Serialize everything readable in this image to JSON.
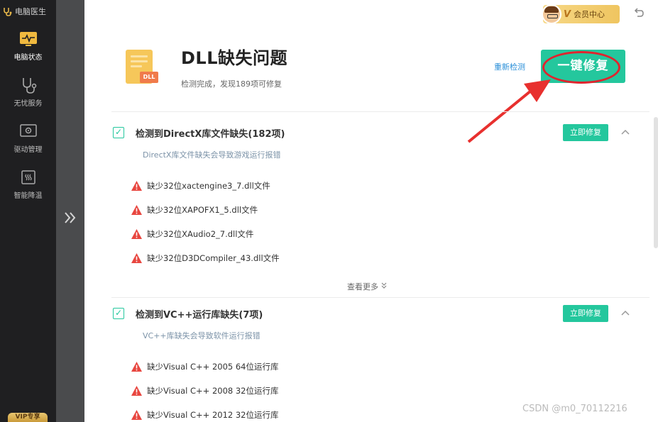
{
  "sidebar": {
    "brand": "电脑医生",
    "items": [
      {
        "label": "电脑状态",
        "icon": "monitor-pulse-icon",
        "active": true
      },
      {
        "label": "无忧服务",
        "icon": "stethoscope-icon",
        "active": false
      },
      {
        "label": "驱动管理",
        "icon": "gear-box-icon",
        "active": false
      },
      {
        "label": "智能降温",
        "icon": "chip-cooling-icon",
        "active": false
      }
    ],
    "vip_label": "VIP专享"
  },
  "top_bar": {
    "member_center": "会员中心",
    "v_badge": "V"
  },
  "header": {
    "icon_tag": "DLL",
    "title": "DLL缺失问题",
    "subtitle": "检测完成，发现189项可修复",
    "recheck": "重新检测",
    "fix_all": "一键修复"
  },
  "sections": [
    {
      "title": "检测到DirectX库文件缺失(182项)",
      "description": "DirectX库文件缺失会导致游戏运行报错",
      "fix_button": "立即修复",
      "checked": true,
      "items": [
        "缺少32位xactengine3_7.dll文件",
        "缺少32位XAPOFX1_5.dll文件",
        "缺少32位XAudio2_7.dll文件",
        "缺少32位D3DCompiler_43.dll文件"
      ],
      "see_more": "查看更多"
    },
    {
      "title": "检测到VC++运行库缺失(7项)",
      "description": "VC++库缺失会导致软件运行报错",
      "fix_button": "立即修复",
      "checked": true,
      "items": [
        "缺少Visual C++ 2005 64位运行库",
        "缺少Visual C++ 2008 32位运行库",
        "缺少Visual C++ 2012 32位运行库"
      ]
    }
  ],
  "watermark": "CSDN @m0_70112216",
  "colors": {
    "accent": "#24c79d",
    "sidebar_bg": "#1f1f21",
    "warning": "#e8463f",
    "link": "#2a8fd8",
    "annotation": "#e0242e"
  }
}
